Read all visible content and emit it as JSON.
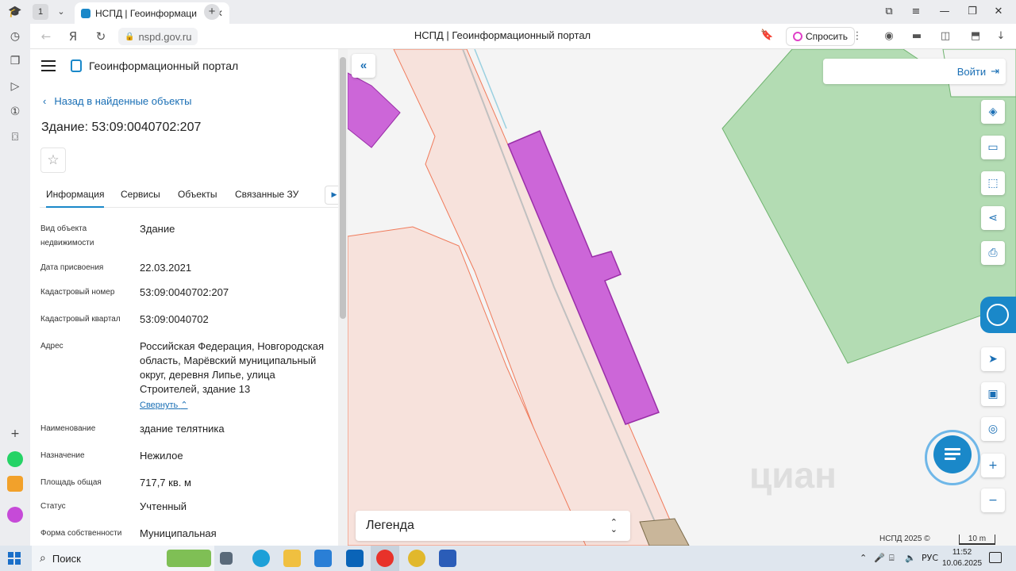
{
  "browser": {
    "tab_count": "1",
    "tab_title": "НСПД | Геоинформаци",
    "url": "nspd.gov.ru",
    "page_title": "НСПД | Геоинформационный портал",
    "ask_label": "Спросить",
    "colors": {
      "tab_icon": "#1a88c9",
      "ask_accent": "#e040c8"
    }
  },
  "panel": {
    "brand": "Геоинформационный портал",
    "back_label": "Назад в найденные объекты",
    "title": "Здание: 53:09:0040702:207",
    "tabs": [
      "Информация",
      "Сервисы",
      "Объекты",
      "Связанные ЗУ"
    ],
    "active_tab": "Информация",
    "collapse_label": "Свернуть",
    "rows": [
      {
        "label": "Вид объекта недвижимости",
        "value": "Здание"
      },
      {
        "label": "Дата присвоения",
        "value": "22.03.2021"
      },
      {
        "label": "Кадастровый номер",
        "value": "53:09:0040702:207"
      },
      {
        "label": "Кадастровый квартал",
        "value": "53:09:0040702"
      },
      {
        "label": "Адрес",
        "value": "Российская Федерация, Новгородская область, Марёвский муниципальный округ, деревня Липье, улица Строителей, здание 13"
      },
      {
        "label": "Наименование",
        "value": "здание телятника"
      },
      {
        "label": "Назначение",
        "value": "Нежилое"
      },
      {
        "label": "Площадь общая",
        "value": "717,7 кв. м"
      },
      {
        "label": "Статус",
        "value": "Учтенный"
      },
      {
        "label": "Форма собственности",
        "value": "Муниципальная"
      }
    ]
  },
  "map": {
    "login_label": "Войти",
    "legend_label": "Легенда",
    "copyright": "НСПД 2025 ©",
    "scale_label": "10 m",
    "watermark": "циан",
    "colors": {
      "building": "#cc66d8",
      "parcel_fill": "#f7e2dc",
      "parcel_line": "#f07a5a",
      "green_area": "#b3dcb3",
      "accent": "#1a88c9"
    },
    "tool_icons": [
      "layers-icon",
      "ruler-icon",
      "select-area-icon",
      "share-icon",
      "print-icon",
      "location-icon",
      "minimap-icon",
      "geolocate-icon",
      "zoom-in-icon",
      "zoom-out-icon"
    ]
  },
  "taskbar": {
    "search_label": "Поиск",
    "language": "РУС",
    "time": "11:52",
    "date": "10.06.2025"
  }
}
